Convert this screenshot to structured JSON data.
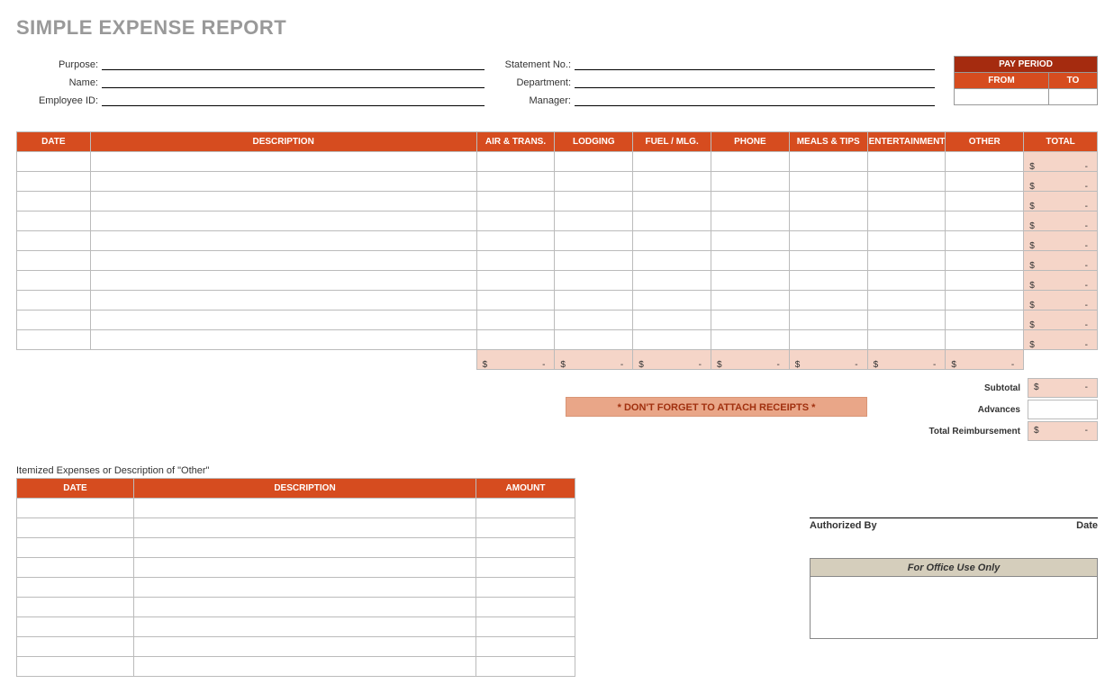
{
  "title": "SIMPLE EXPENSE REPORT",
  "meta": {
    "purpose_label": "Purpose:",
    "name_label": "Name:",
    "employee_id_label": "Employee ID:",
    "statement_no_label": "Statement No.:",
    "department_label": "Department:",
    "manager_label": "Manager:"
  },
  "pay_period": {
    "title": "PAY PERIOD",
    "from": "FROM",
    "to": "TO"
  },
  "columns": {
    "date": "DATE",
    "desc": "DESCRIPTION",
    "air": "AIR & TRANS.",
    "lodging": "LODGING",
    "fuel": "FUEL / MLG.",
    "phone": "PHONE",
    "meals": "MEALS & TIPS",
    "ent": "ENTERTAINMENT",
    "other": "OTHER",
    "total": "TOTAL"
  },
  "row_count": 10,
  "currency": "$",
  "dash": "-",
  "receipts_note": "* DON'T FORGET TO ATTACH RECEIPTS *",
  "summary": {
    "subtotal": "Subtotal",
    "advances": "Advances",
    "total_reimb": "Total Reimbursement"
  },
  "itemized": {
    "title": "Itemized Expenses or Description of \"Other\"",
    "date": "DATE",
    "desc": "DESCRIPTION",
    "amount": "AMOUNT",
    "row_count": 9
  },
  "sig": {
    "auth": "Authorized By",
    "date": "Date"
  },
  "office": "For Office Use Only"
}
